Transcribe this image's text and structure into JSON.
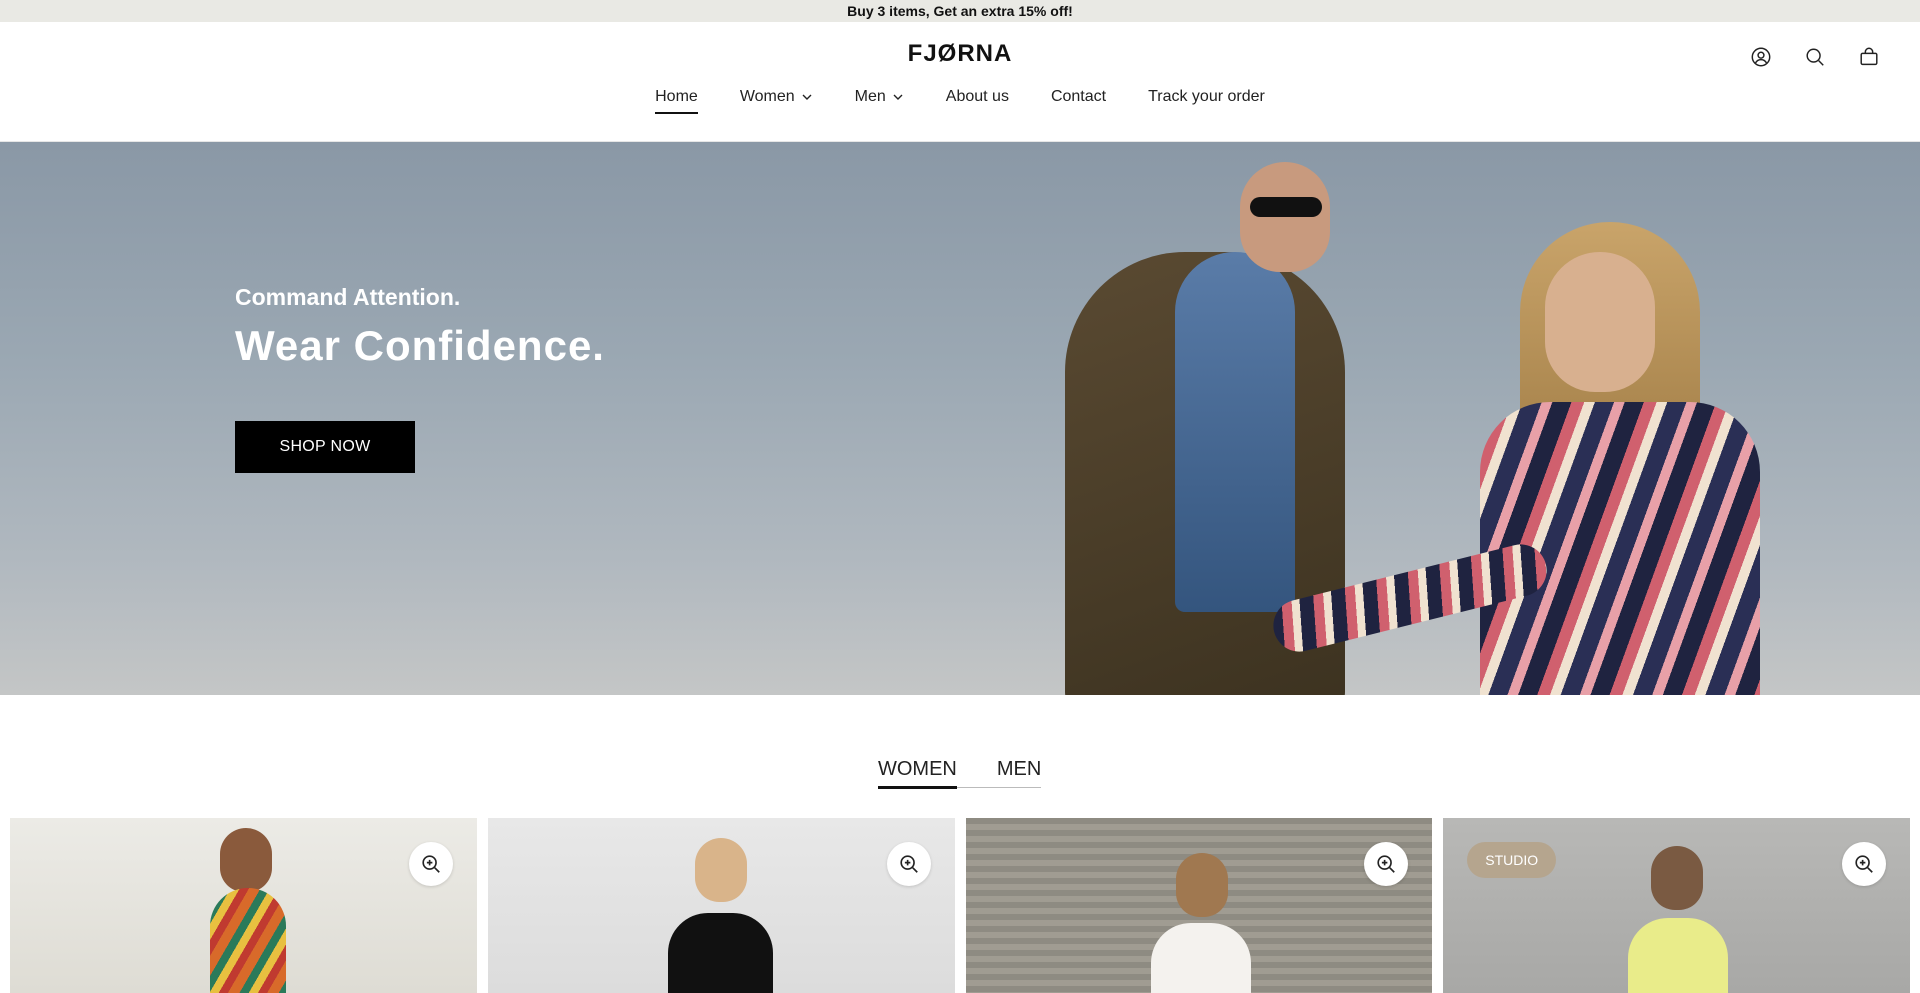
{
  "announcement": "Buy 3 items, Get an extra 15% off!",
  "header": {
    "logo": "FJØRNA",
    "icons": [
      "account-icon",
      "search-icon",
      "cart-icon"
    ]
  },
  "nav": {
    "items": [
      {
        "label": "Home",
        "active": true,
        "dropdown": false
      },
      {
        "label": "Women",
        "active": false,
        "dropdown": true
      },
      {
        "label": "Men",
        "active": false,
        "dropdown": true
      },
      {
        "label": "About us",
        "active": false,
        "dropdown": false
      },
      {
        "label": "Contact",
        "active": false,
        "dropdown": false
      },
      {
        "label": "Track your order",
        "active": false,
        "dropdown": false
      }
    ]
  },
  "hero": {
    "subtitle": "Command Attention.",
    "title": "Wear Confidence.",
    "cta": "SHOP NOW"
  },
  "tabs": [
    {
      "label": "WOMEN",
      "active": true
    },
    {
      "label": "MEN",
      "active": false
    }
  ],
  "products": [
    {
      "badge": null,
      "zoom_icon": "zoom-in-icon"
    },
    {
      "badge": null,
      "zoom_icon": "zoom-in-icon"
    },
    {
      "badge": null,
      "zoom_icon": "zoom-in-icon"
    },
    {
      "badge": "STUDIO",
      "zoom_icon": "zoom-in-icon"
    }
  ],
  "colors": {
    "announcement_bg": "#e9e9e4",
    "cta_bg": "#000000",
    "badge_bg": "#b5a58e"
  }
}
